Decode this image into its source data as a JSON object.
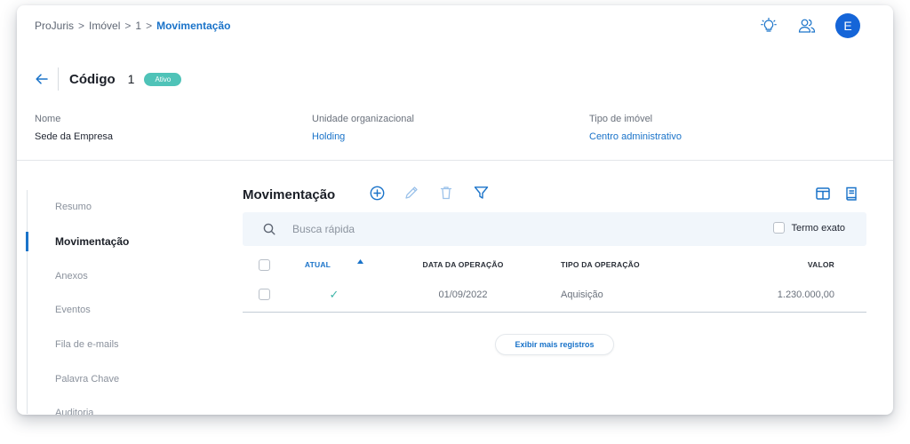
{
  "breadcrumb": {
    "items": [
      "ProJuris",
      "Imóvel",
      "1"
    ],
    "current": "Movimentação",
    "separator": ">"
  },
  "header": {
    "avatar_initial": "E",
    "icons": [
      "lightbulb-icon",
      "users-icon"
    ]
  },
  "record": {
    "title_label": "Código",
    "title_value": "1",
    "status": "Ativo"
  },
  "fields": [
    {
      "label": "Nome",
      "value": "Sede da Empresa"
    },
    {
      "label": "Unidade organizacional",
      "value": "Holding"
    },
    {
      "label": "Tipo de imóvel",
      "value": "Centro administrativo"
    }
  ],
  "sidenav": {
    "items": [
      "Resumo",
      "Movimentação",
      "Anexos",
      "Eventos",
      "Fila de e-mails",
      "Palavra Chave",
      "Auditoria"
    ],
    "active": "Movimentação"
  },
  "main": {
    "title": "Movimentação",
    "search_placeholder": "Busca rápida",
    "exact_label": "Termo exato",
    "columns": [
      "ATUAL",
      "DATA DA OPERAÇÃO",
      "TIPO DA OPERAÇÃO",
      "VALOR"
    ],
    "rows": [
      {
        "atual": "✓",
        "data": "01/09/2022",
        "tipo": "Aquisição",
        "valor": "1.230.000,00"
      }
    ],
    "more_label": "Exibir mais registros"
  },
  "colors": {
    "accent": "#1a73c9",
    "status_badge": "#4fc3b8",
    "avatar": "#1565d8"
  }
}
